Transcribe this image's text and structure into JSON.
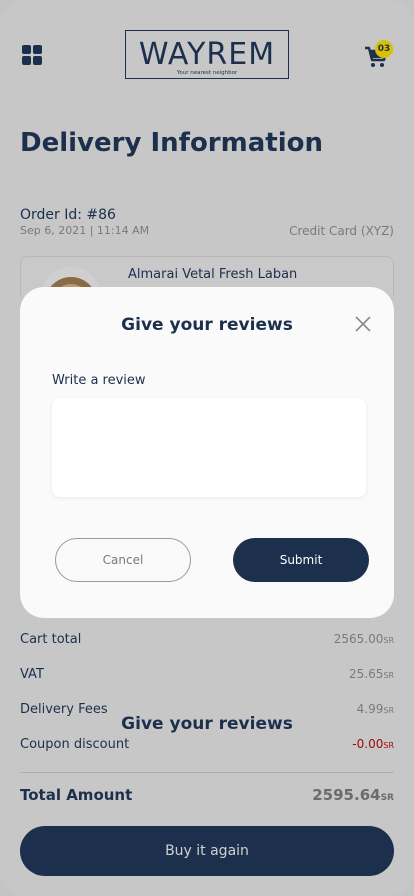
{
  "header": {
    "logo_text": "WAYREM",
    "logo_tagline": "Your nearest neighbor",
    "cart_count": "03"
  },
  "page_title": "Delivery Information",
  "order": {
    "id_label": "Order Id: #86",
    "date": "Sep 6, 2021 | 11:14 AM",
    "payment_method": "Credit Card (XYZ)"
  },
  "product": {
    "name": "Almarai Vetal Fresh Laban"
  },
  "summary": {
    "currency": "SR",
    "rows": [
      {
        "label": "Cart total",
        "value": "2565.00"
      },
      {
        "label": "VAT",
        "value": "25.65"
      },
      {
        "label": "Delivery Fees",
        "value": "4.99"
      },
      {
        "label": "Coupon discount",
        "value": "-0.00"
      }
    ],
    "total_label": "Total Amount",
    "total_value": "2595.64"
  },
  "background_title": "Give your reviews",
  "buy_again_label": "Buy it again",
  "modal": {
    "title": "Give your reviews",
    "review_label": "Write a review",
    "review_value": "",
    "cancel_label": "Cancel",
    "submit_label": "Submit"
  },
  "colors": {
    "primary": "#1c2f4d",
    "badge": "#d6c200",
    "negative": "#a10b0b",
    "overlay": "#c7c7c7"
  },
  "icons": [
    "menu-grid-icon",
    "cart-icon",
    "close-icon"
  ]
}
